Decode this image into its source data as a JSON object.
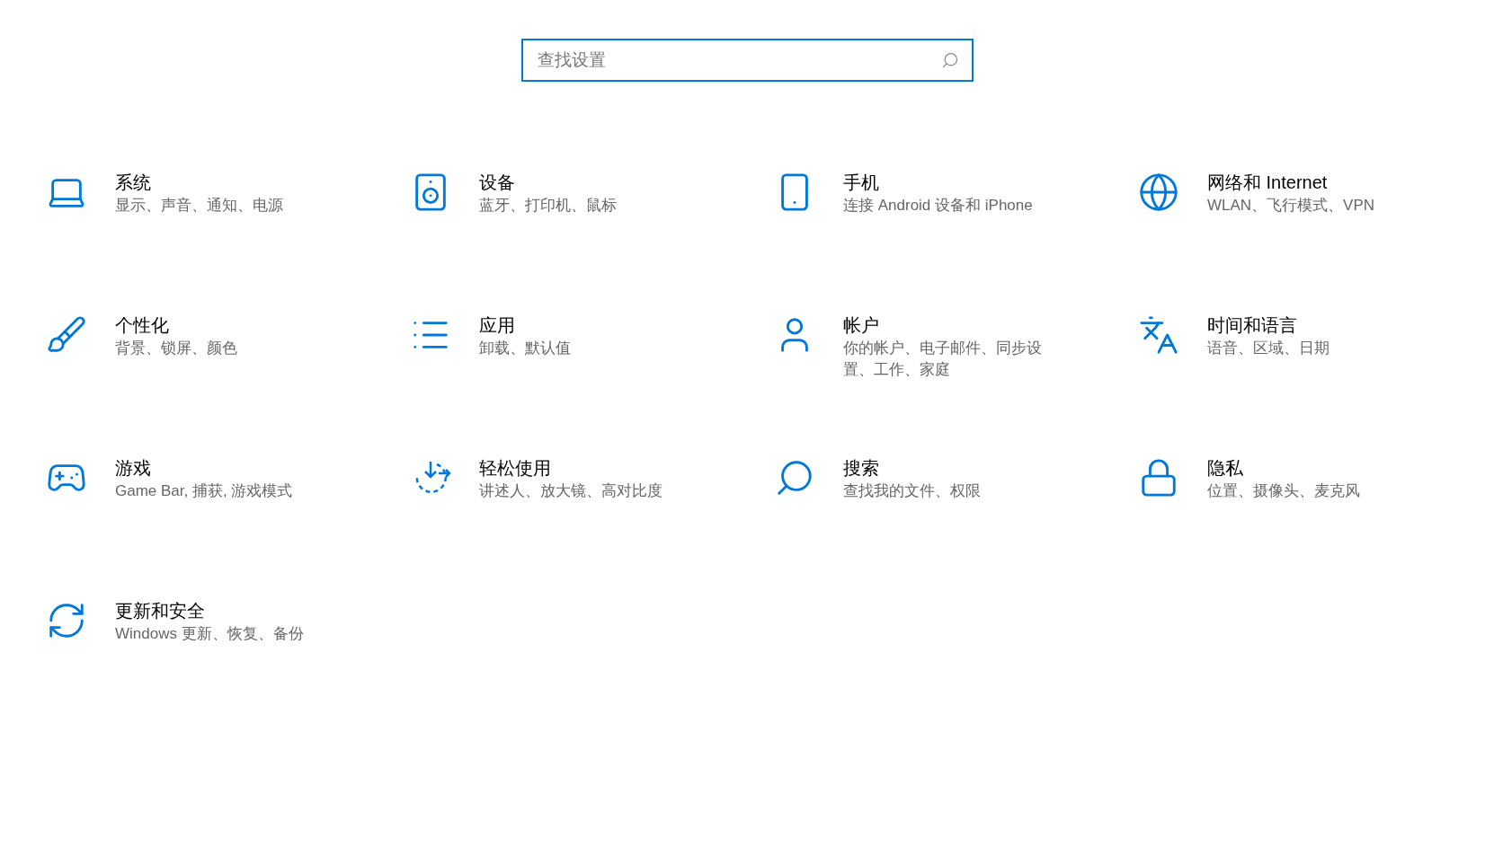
{
  "search": {
    "placeholder": "查找设置"
  },
  "categories": [
    {
      "kind": "system",
      "title": "系统",
      "subtitle": "显示、声音、通知、电源"
    },
    {
      "kind": "devices",
      "title": "设备",
      "subtitle": "蓝牙、打印机、鼠标"
    },
    {
      "kind": "phone",
      "title": "手机",
      "subtitle": "连接 Android 设备和 iPhone"
    },
    {
      "kind": "network",
      "title": "网络和 Internet",
      "subtitle": "WLAN、飞行模式、VPN"
    },
    {
      "kind": "personalization",
      "title": "个性化",
      "subtitle": "背景、锁屏、颜色"
    },
    {
      "kind": "apps",
      "title": "应用",
      "subtitle": "卸载、默认值"
    },
    {
      "kind": "accounts",
      "title": "帐户",
      "subtitle": "你的帐户、电子邮件、同步设置、工作、家庭"
    },
    {
      "kind": "time",
      "title": "时间和语言",
      "subtitle": "语音、区域、日期"
    },
    {
      "kind": "gaming",
      "title": "游戏",
      "subtitle": "Game Bar, 捕获, 游戏模式"
    },
    {
      "kind": "ease",
      "title": "轻松使用",
      "subtitle": "讲述人、放大镜、高对比度"
    },
    {
      "kind": "search",
      "title": "搜索",
      "subtitle": "查找我的文件、权限"
    },
    {
      "kind": "privacy",
      "title": "隐私",
      "subtitle": "位置、摄像头、麦克风"
    },
    {
      "kind": "update",
      "title": "更新和安全",
      "subtitle": "Windows 更新、恢复、备份"
    }
  ]
}
